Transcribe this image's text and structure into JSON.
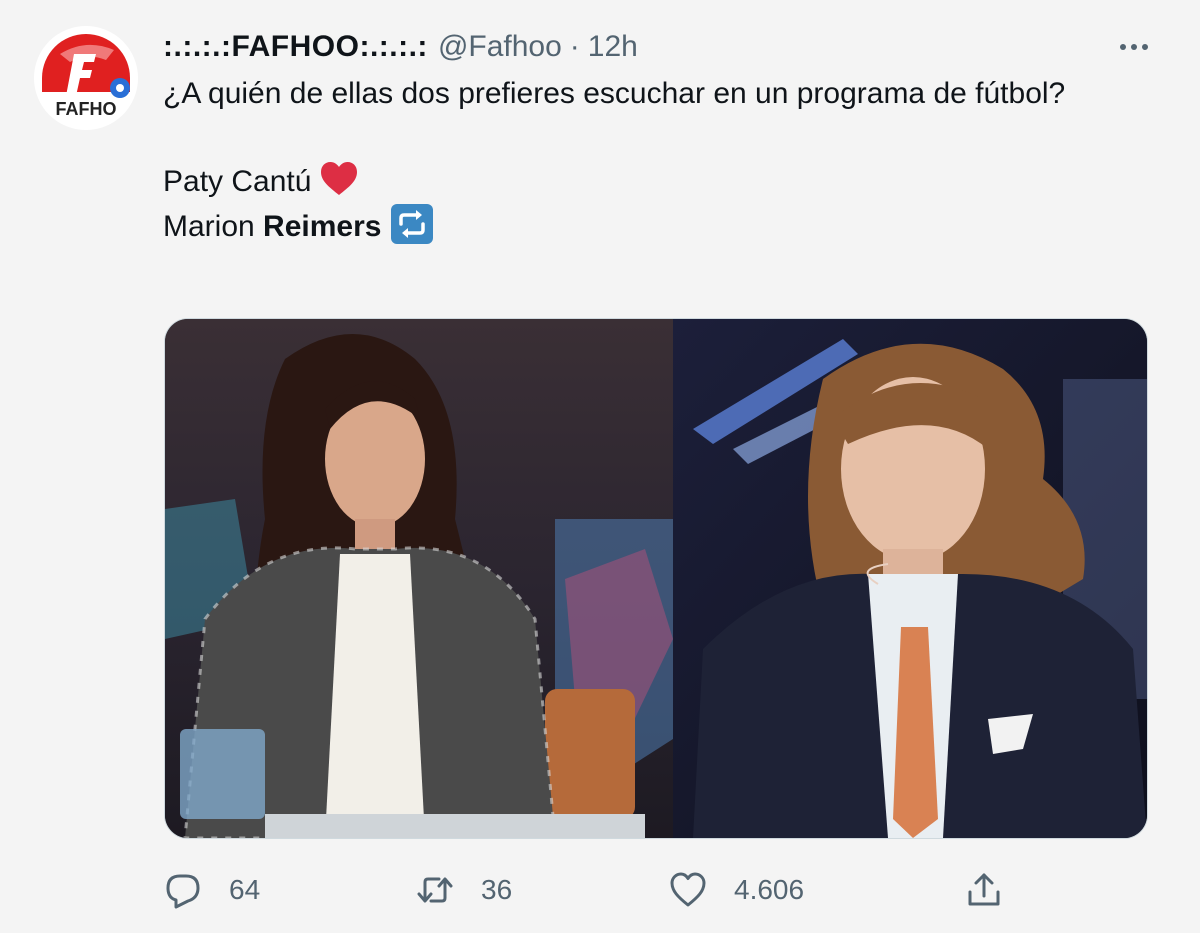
{
  "tweet": {
    "display_name": ":.:.:.:FAFHOO:.:.:.:",
    "handle": "@Fafhoo",
    "separator": "·",
    "time": "12h",
    "avatar_text": "FAFHO",
    "line1": "¿A quién de ellas dos prefieres escuchar en un programa de fútbol?",
    "option1": "Paty Cantú",
    "option2_first": "Marion",
    "option2_last": "Reimers"
  },
  "icons": {
    "more": "more-horizontal-icon",
    "reply": "reply-icon",
    "retweet": "retweet-icon",
    "like": "heart-icon",
    "share": "share-icon",
    "heart_emoji": "red-heart-emoji",
    "retweet_emoji": "repeat-emoji"
  },
  "actions": {
    "replies": "64",
    "retweets": "36",
    "likes": "4.606"
  },
  "colors": {
    "text": "#0f1419",
    "secondary": "#536471",
    "heart": "#dd2e44",
    "repeat_emoji": "#3b88c3",
    "avatar_red": "#e02020"
  }
}
